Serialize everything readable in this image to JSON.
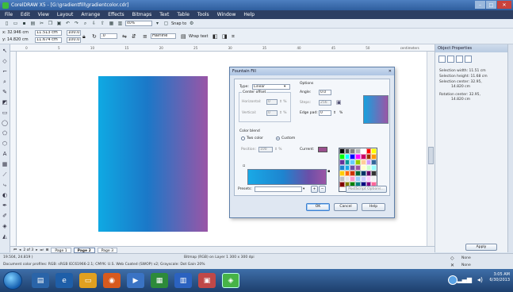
{
  "window": {
    "title": "CorelDRAW X5 - [G:\\gradientfill\\gradientcolor.cdr]",
    "controls": [
      "–",
      "□",
      "✕"
    ]
  },
  "menu": [
    "File",
    "Edit",
    "View",
    "Layout",
    "Arrange",
    "Effects",
    "Bitmaps",
    "Text",
    "Table",
    "Tools",
    "Window",
    "Help"
  ],
  "toolbar": {
    "zoom": "40%",
    "snap": "Snap to"
  },
  "propbar": {
    "x": "x: 32.946 cm",
    "y": "y: 14.820 cm",
    "w": "11.513 cm",
    "h": "11.674 cm",
    "scale1": "100.0",
    "scale2": "100.0",
    "angle": ".0",
    "outline": "Hairline",
    "wrap": "Wrap text"
  },
  "ruler": {
    "ticks": [
      "0",
      "5",
      "10",
      "15",
      "20",
      "25",
      "30",
      "35",
      "40",
      "45",
      "50",
      "centimeters"
    ]
  },
  "canvas": {
    "rect_gradient": {
      "start": "#0fa9e3",
      "mid": "#1b78c8",
      "end": "#9a55a6"
    }
  },
  "dialog": {
    "title": "Fountain Fill",
    "close": "✕",
    "type_label": "Type:",
    "type_value": "Linear",
    "center_offset": "Center offset",
    "horizontal_label": "Horizontal:",
    "horizontal_value": "0",
    "vertical_label": "Vertical:",
    "vertical_value": "0",
    "options_label": "Options",
    "angle_label": "Angle:",
    "angle_value": "0.0",
    "steps_label": "Steps:",
    "steps_value": "256",
    "edge_pad_label": "Edge pad:",
    "edge_pad_value": "0",
    "edge_pad_unit": "%",
    "color_blend_label": "Color blend",
    "two_color_label": "Two color",
    "custom_label": "Custom",
    "position_label": "Position:",
    "position_value": "100",
    "current_label": "Current:",
    "presets_label": "Presets:",
    "postscript_label": "PostScript Options...",
    "ok_label": "OK",
    "cancel_label": "Cancel",
    "help_label": "Help",
    "palette_colors": [
      "#000000",
      "#4d4d4d",
      "#808080",
      "#b3b3b3",
      "#ffffff",
      "#ff0000",
      "#ffff00",
      "#00ff00",
      "#00ffff",
      "#0000ff",
      "#ff00ff",
      "#cc0066",
      "#993300",
      "#ff9900",
      "#663399",
      "#009999",
      "#66ccff",
      "#99cc00",
      "#ffcc99",
      "#cc99ff",
      "#336699",
      "#1e84cf",
      "#19a9e6",
      "#6b4fa8",
      "#9c56a5",
      "#ffffcc",
      "#ccffcc",
      "#99ffff",
      "#ffcc00",
      "#ff6600",
      "#cc3300",
      "#006633",
      "#003366",
      "#660066",
      "#333333",
      "#c0c0c0",
      "#e6e6e6",
      "#ff99cc",
      "#99ccff",
      "#ccccff",
      "#ffccff",
      "#f2f2f2",
      "#800000",
      "#808000",
      "#008000",
      "#008080",
      "#000080",
      "#800080",
      "#ff6699"
    ]
  },
  "dock": {
    "title": "Object Properties",
    "close": "✕",
    "line1": "Selection width: 11.51 cm",
    "line2": "Selection height: 11.68 cm",
    "line3": "Selection center: 32.95,",
    "line3b": "14.820 cm",
    "line4": "Rotation center: 32.95,",
    "line4b": "14.820 cm",
    "apply": "Apply"
  },
  "pager": {
    "counter": "2 of 3",
    "pages": [
      "Page 1",
      "Page 2",
      "Page 3"
    ]
  },
  "status": {
    "coords": "19.504, 24.819 )",
    "object": "Bitmap (RGB) on Layer 1 300 x 300 dpi",
    "profile": "Document color profiles: RGB: sRGB IEC61966-2.1; CMYK: U.S. Web Coated (SWOP) v2; Grayscale: Dot Gain 20%",
    "fill": "None",
    "outline": "None"
  },
  "taskbar": {
    "apps": [
      "start",
      "ie",
      "explorer",
      "media",
      "firefox",
      "app1",
      "app2",
      "app3",
      "app4",
      "corel"
    ],
    "time": "3:05 AM",
    "date": "6/30/2013"
  }
}
